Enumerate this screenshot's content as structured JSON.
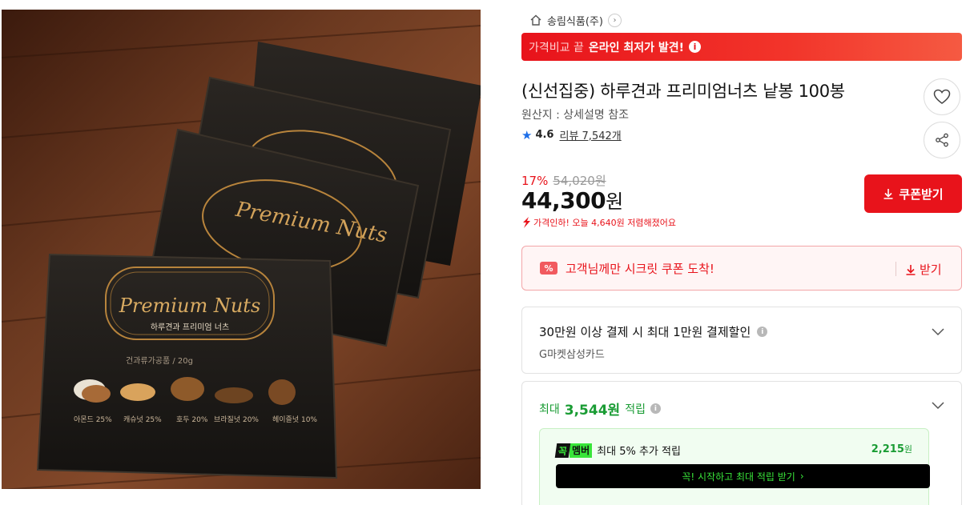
{
  "seller": {
    "name": "송림식품(주)",
    "home_icon": "home-icon",
    "chevron": "›"
  },
  "banner": {
    "prefix": "가격비교 끝",
    "headline": "온라인 최저가 발견!",
    "info": "i"
  },
  "product": {
    "title": "(신선집중) 하루견과 프리미엄너츠 낱봉 100봉",
    "origin": "원산지 : 상세설명 참조",
    "rating": "4.6",
    "review_label": "리뷰 7,542개"
  },
  "price": {
    "discount_rate": "17%",
    "original": "54,020원",
    "sale_number": "44,300",
    "sale_unit": "원",
    "drop_note": "가격인하! 오늘 4,640원 저렴해졌어요"
  },
  "coupon_button": {
    "label": "쿠폰받기"
  },
  "secret_coupon": {
    "icon_text": "%",
    "text": "고객님께만 시크릿 쿠폰 도착!",
    "action": "받기"
  },
  "card_offer": {
    "title": "30만원 이상 결제 시 최대 1만원 결제할인",
    "info": "i",
    "subtitle": "G마켓삼성카드"
  },
  "points": {
    "prefix": "최대",
    "amount": "3,544원",
    "suffix": "적립",
    "info": "i",
    "member": {
      "badge1": "꼭",
      "badge2": "멤버",
      "text": "최대 5% 추가 적립",
      "value": "2,215",
      "unit": "원",
      "cta": "꼭! 시작하고 최대 적립 받기",
      "cta_arrow": "›"
    }
  },
  "image": {
    "pack_brand": "Premium Nuts",
    "pack_name": "하루견과 프리미엄 너츠",
    "pack_weight": "건과류가공품 / 20g",
    "nuts": [
      "아몬드 25%",
      "캐슈넛 25%",
      "호두 20%",
      "브라질넛 20%",
      "헤이즐넛 10%"
    ]
  },
  "colors": {
    "accent": "#e8131b",
    "green": "#1a9c34",
    "member_green": "#39e53a"
  }
}
